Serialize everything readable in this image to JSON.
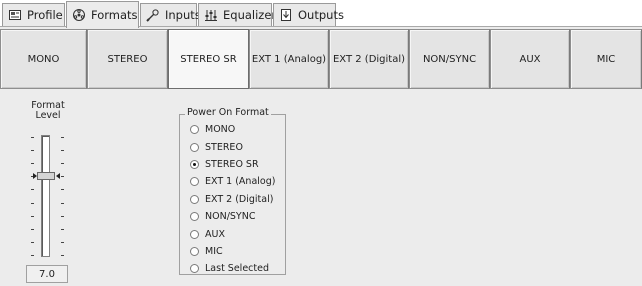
{
  "tabs": [
    {
      "label": "Profile",
      "icon": "profile-icon"
    },
    {
      "label": "Formats",
      "icon": "formats-icon"
    },
    {
      "label": "Inputs",
      "icon": "inputs-icon"
    },
    {
      "label": "Equalizer",
      "icon": "equalizer-icon"
    },
    {
      "label": "Outputs",
      "icon": "outputs-icon"
    }
  ],
  "active_tab": "Formats",
  "format_buttons": [
    "MONO",
    "STEREO",
    "STEREO SR",
    "EXT 1 (Analog)",
    "EXT 2 (Digital)",
    "NON/SYNC",
    "AUX",
    "MIC"
  ],
  "active_format": "STEREO SR",
  "format_level": {
    "label_line1": "Format",
    "label_line2": "Level",
    "value": "7.0",
    "slider_fraction_from_top": 0.34
  },
  "power_on_format": {
    "title": "Power On Format",
    "options": [
      "MONO",
      "STEREO",
      "STEREO SR",
      "EXT 1 (Analog)",
      "EXT 2 (Digital)",
      "NON/SYNC",
      "AUX",
      "MIC",
      "Last Selected"
    ],
    "selected": "STEREO SR"
  }
}
